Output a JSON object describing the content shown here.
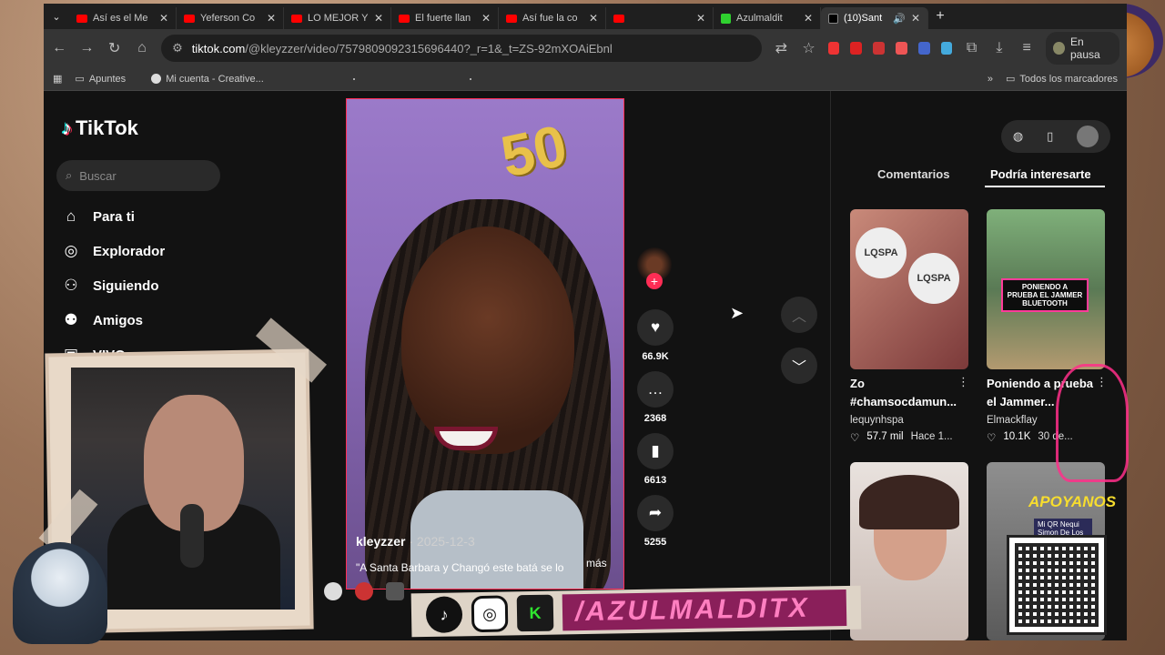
{
  "browser": {
    "tabs": [
      {
        "title": "Así es el Me",
        "icon": "youtube-icon"
      },
      {
        "title": "Yeferson Co",
        "icon": "youtube-icon"
      },
      {
        "title": "LO MEJOR Y",
        "icon": "youtube-icon"
      },
      {
        "title": "El fuerte llan",
        "icon": "youtube-icon"
      },
      {
        "title": "Así fue la co",
        "icon": "youtube-icon"
      },
      {
        "title": "",
        "icon": "youtube-icon"
      },
      {
        "title": "Azulmaldit",
        "icon": "kick-icon"
      },
      {
        "title": "(10)Sant",
        "icon": "tiktok-icon",
        "active": true
      }
    ],
    "url_domain": "tiktok.com",
    "url_rest": "/@kleyzzer/video/7579809092315696440?_r=1&_t=ZS-92mXOAiEbnl",
    "profile_status": "En pausa",
    "bookmarks": [
      "Apuntes",
      "Mi cuenta - Creative...",
      "Todos los marcadores"
    ]
  },
  "tiktok": {
    "logo": "TikTok",
    "search_placeholder": "Buscar",
    "nav": [
      {
        "label": "Para ti",
        "icon": "home-icon"
      },
      {
        "label": "Explorador",
        "icon": "compass-icon"
      },
      {
        "label": "Siguiendo",
        "icon": "following-icon"
      },
      {
        "label": "Amigos",
        "icon": "friends-icon"
      },
      {
        "label": "VIVO",
        "icon": "live-icon"
      }
    ],
    "video": {
      "username": "kleyzzer",
      "date": "· 2025-12-3",
      "caption": "\"A Santa Barbara y Changó este batá se lo",
      "more": "más",
      "balloon_text": "50"
    },
    "actions": {
      "likes": "66.9K",
      "comments": "2368",
      "saves": "6613",
      "shares": "5255"
    },
    "panel_tabs": {
      "comments": "Comentarios",
      "suggested": "Podría interesarte"
    },
    "suggestions": [
      {
        "title": "Zo #chamsocdamun...",
        "author": "lequynhspa",
        "stats": "57.7 mil",
        "age": "Hace 1...",
        "thumb_text_1": "LQSPA",
        "thumb_text_2": "LQSPA"
      },
      {
        "title": "Poniendo a prueba el Jammer...",
        "author": "Elmackflay",
        "stats": "10.1K",
        "age": "30 de...",
        "badge": "PONIENDO A PRUEBA EL JAMMER BLUETOOTH"
      },
      {
        "title": "",
        "author": "",
        "stats": "",
        "age": ""
      },
      {
        "title": "",
        "author": "",
        "stats": "",
        "age": ""
      }
    ]
  },
  "overlay": {
    "handle": "/AZULMALDITX",
    "apoyanos": "APOYANOS",
    "qr_label": "Mi QR Nequi Simon De Los Ríos"
  }
}
